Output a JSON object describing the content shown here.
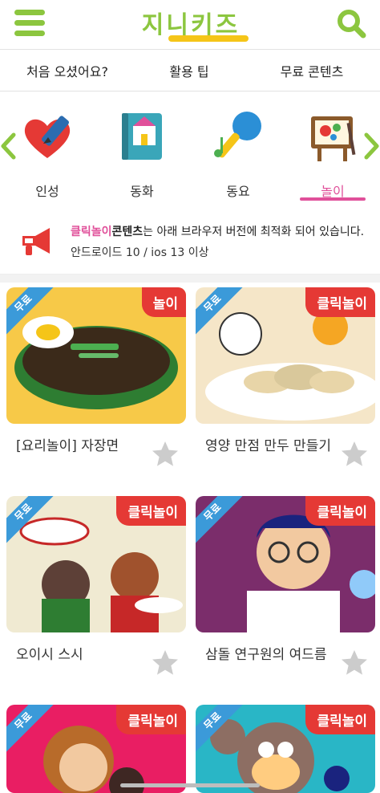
{
  "header": {
    "logo_text": "지니키즈",
    "menu_icon": "hamburger-menu-icon",
    "search_icon": "search-icon",
    "brand_color": "#8cc63f"
  },
  "topnav": {
    "items": [
      {
        "label": "처음 오셨어요?"
      },
      {
        "label": "활용 팁"
      },
      {
        "label": "무료 콘텐츠"
      }
    ]
  },
  "categories": {
    "items": [
      {
        "label": "인성",
        "icon": "heart-pencil-icon"
      },
      {
        "label": "동화",
        "icon": "storybook-icon"
      },
      {
        "label": "동요",
        "icon": "microphone-icon"
      },
      {
        "label": "놀이",
        "icon": "easel-paint-icon",
        "active": true
      }
    ],
    "active_color": "#e0509a"
  },
  "notice": {
    "highlight": "클릭놀이",
    "bold": "콘텐츠",
    "text": "는 아래 브라우저 버전에 최적화 되어 있습니다.",
    "requirement": "안드로이드 10 / ios 13 이상"
  },
  "cards": [
    {
      "title": "[요리놀이] 자장면",
      "badge_free": "무료",
      "badge_type": "놀이"
    },
    {
      "title": "영양 만점 만두 만들기",
      "badge_free": "무료",
      "badge_type": "클릭놀이"
    },
    {
      "title": "오이시 스시",
      "badge_free": "무료",
      "badge_type": "클릭놀이"
    },
    {
      "title": "삼돌 연구원의 여드름",
      "badge_free": "무료",
      "badge_type": "클릭놀이"
    },
    {
      "title": "",
      "badge_free": "무료",
      "badge_type": "클릭놀이"
    },
    {
      "title": "",
      "badge_free": "무료",
      "badge_type": "클릭놀이"
    }
  ],
  "colors": {
    "free_badge": "#3b9ad9",
    "type_badge": "#e53935",
    "favorite_star": "#cccccc"
  }
}
